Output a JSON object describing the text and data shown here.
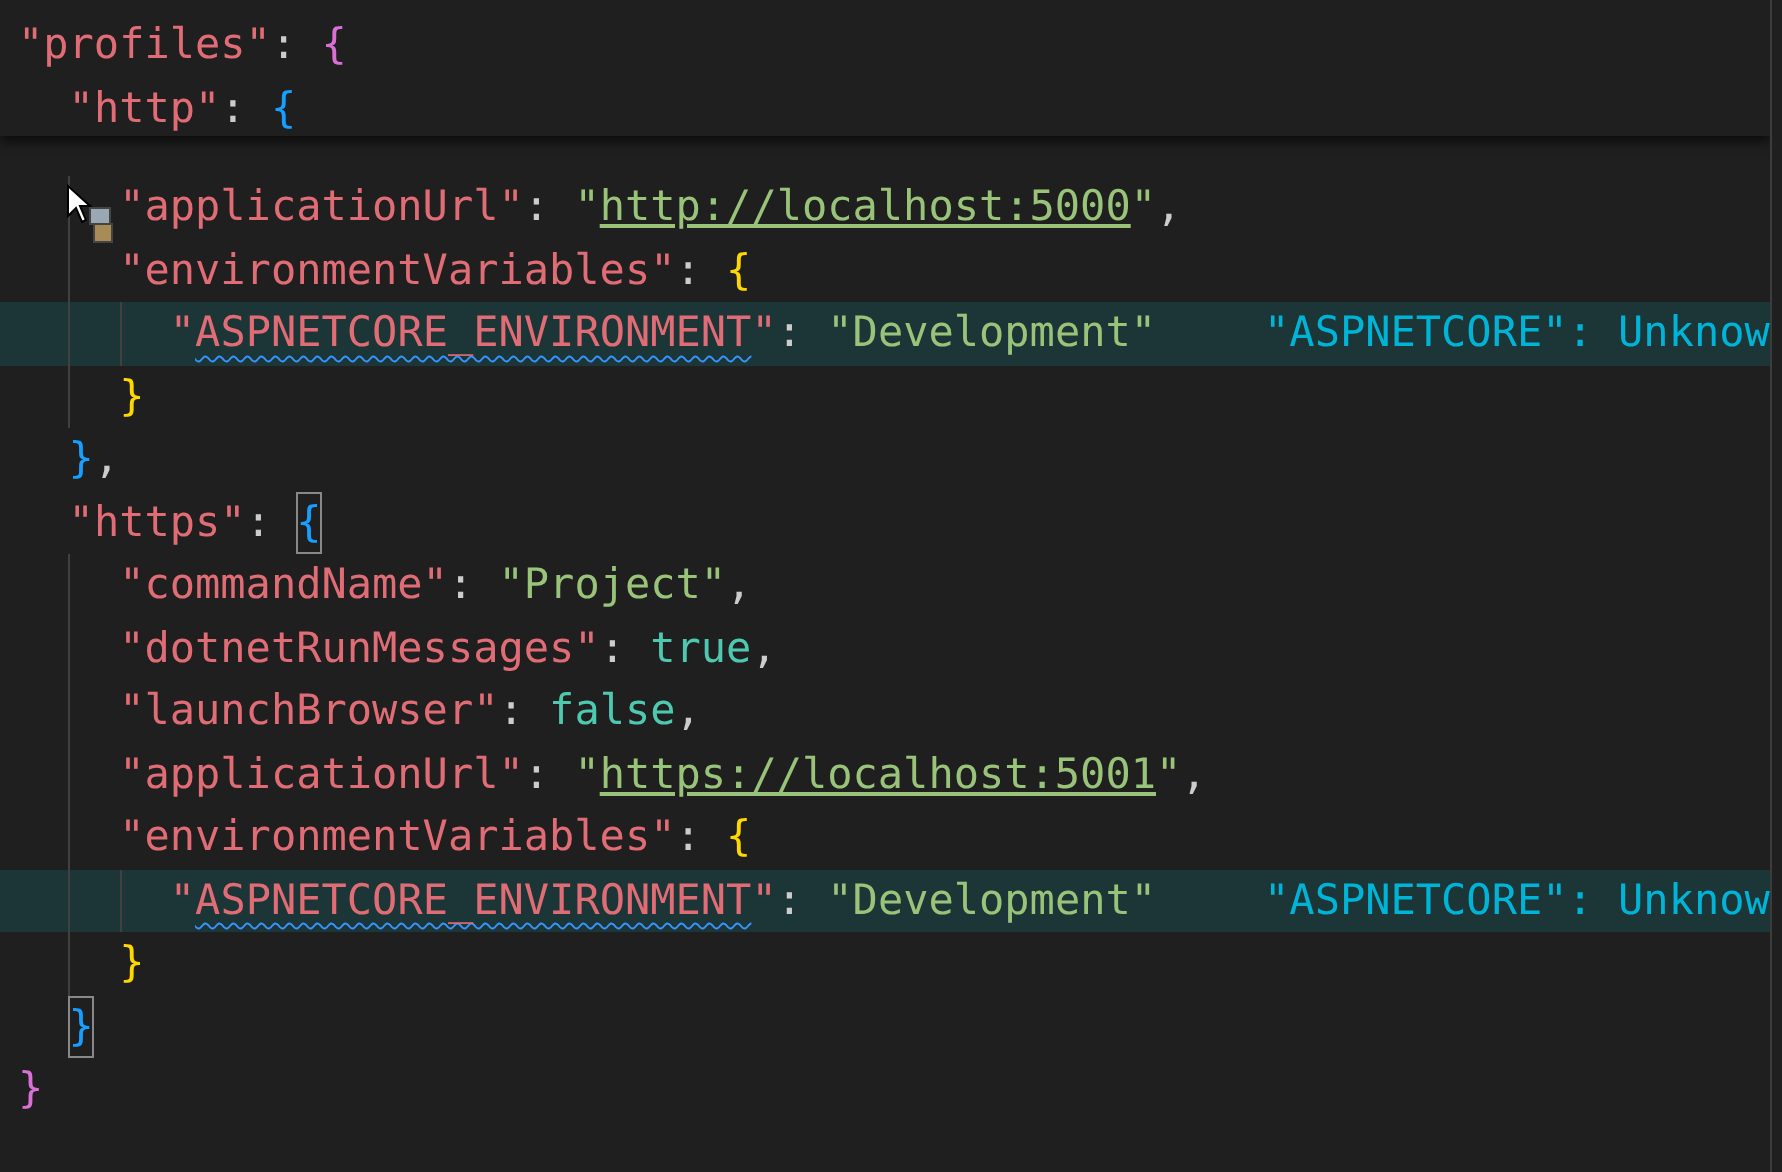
{
  "code": [
    {
      "sticky": true,
      "tokens": [
        {
          "kind": "key",
          "text": "\"profiles\""
        },
        {
          "kind": "punct",
          "text": ": "
        },
        {
          "kind": "brace",
          "text": "{",
          "color": "#da70d6",
          "bracket_match": false
        }
      ],
      "children": [
        {
          "sticky": true,
          "tokens": [
            {
              "kind": "key",
              "text": "\"http\""
            },
            {
              "kind": "punct",
              "text": ": "
            },
            {
              "kind": "brace",
              "text": "{",
              "color": "#179fff",
              "bracket_match": false
            }
          ],
          "children": [
            {
              "tokens": [
                {
                  "kind": "key",
                  "text": "\"applicationUrl\""
                },
                {
                  "kind": "punct",
                  "text": ": "
                },
                {
                  "kind": "string",
                  "text": "\""
                },
                {
                  "kind": "url",
                  "text": "http://localhost:5000"
                },
                {
                  "kind": "string",
                  "text": "\""
                },
                {
                  "kind": "punct",
                  "text": ","
                }
              ]
            },
            {
              "tokens": [
                {
                  "kind": "key",
                  "text": "\"environmentVariables\""
                },
                {
                  "kind": "punct",
                  "text": ": "
                },
                {
                  "kind": "brace",
                  "text": "{",
                  "color": "#ffd700",
                  "bracket_match": false
                }
              ],
              "children": [
                {
                  "highlighted": true,
                  "tokens": [
                    {
                      "kind": "key",
                      "text": "\""
                    },
                    {
                      "kind": "key",
                      "text": "ASPNETCORE_ENVIRONMENT",
                      "warning": true
                    },
                    {
                      "kind": "key",
                      "text": "\""
                    },
                    {
                      "kind": "punct",
                      "text": ": "
                    },
                    {
                      "kind": "string",
                      "text": "\"Development\""
                    },
                    {
                      "kind": "hint",
                      "text": "\"ASPNETCORE\": Unknow"
                    }
                  ]
                }
              ]
            },
            {
              "tokens": [
                {
                  "kind": "brace",
                  "text": "}",
                  "color": "#ffd700",
                  "bracket_match": false
                }
              ]
            }
          ]
        },
        {
          "tokens": [
            {
              "kind": "brace",
              "text": "}",
              "color": "#179fff",
              "bracket_match": false
            },
            {
              "kind": "punct",
              "text": ","
            }
          ]
        },
        {
          "tokens": [
            {
              "kind": "key",
              "text": "\"https\""
            },
            {
              "kind": "punct",
              "text": ": "
            },
            {
              "kind": "brace",
              "text": "{",
              "color": "#179fff",
              "bracket_match": true
            }
          ],
          "children": [
            {
              "tokens": [
                {
                  "kind": "key",
                  "text": "\"commandName\""
                },
                {
                  "kind": "punct",
                  "text": ": "
                },
                {
                  "kind": "string",
                  "text": "\"Project\""
                },
                {
                  "kind": "punct",
                  "text": ","
                }
              ]
            },
            {
              "tokens": [
                {
                  "kind": "key",
                  "text": "\"dotnetRunMessages\""
                },
                {
                  "kind": "punct",
                  "text": ": "
                },
                {
                  "kind": "bool",
                  "text": "true"
                },
                {
                  "kind": "punct",
                  "text": ","
                }
              ]
            },
            {
              "tokens": [
                {
                  "kind": "key",
                  "text": "\"launchBrowser\""
                },
                {
                  "kind": "punct",
                  "text": ": "
                },
                {
                  "kind": "bool",
                  "text": "false"
                },
                {
                  "kind": "punct",
                  "text": ","
                }
              ]
            },
            {
              "tokens": [
                {
                  "kind": "key",
                  "text": "\"applicationUrl\""
                },
                {
                  "kind": "punct",
                  "text": ": "
                },
                {
                  "kind": "string",
                  "text": "\""
                },
                {
                  "kind": "url",
                  "text": "https://localhost:5001"
                },
                {
                  "kind": "string",
                  "text": "\""
                },
                {
                  "kind": "punct",
                  "text": ","
                }
              ]
            },
            {
              "tokens": [
                {
                  "kind": "key",
                  "text": "\"environmentVariables\""
                },
                {
                  "kind": "punct",
                  "text": ": "
                },
                {
                  "kind": "brace",
                  "text": "{",
                  "color": "#ffd700",
                  "bracket_match": false
                }
              ],
              "children": [
                {
                  "highlighted": true,
                  "tokens": [
                    {
                      "kind": "key",
                      "text": "\""
                    },
                    {
                      "kind": "key",
                      "text": "ASPNETCORE_ENVIRONMENT",
                      "warning": true
                    },
                    {
                      "kind": "key",
                      "text": "\""
                    },
                    {
                      "kind": "punct",
                      "text": ": "
                    },
                    {
                      "kind": "string",
                      "text": "\"Development\""
                    },
                    {
                      "kind": "hint",
                      "text": "\"ASPNETCORE\": Unknow"
                    }
                  ]
                }
              ]
            },
            {
              "tokens": [
                {
                  "kind": "brace",
                  "text": "}",
                  "color": "#ffd700",
                  "bracket_match": false
                }
              ]
            }
          ]
        },
        {
          "tokens": [
            {
              "kind": "brace",
              "text": "}",
              "color": "#179fff",
              "bracket_match": true
            }
          ]
        }
      ]
    },
    {
      "tokens": [
        {
          "kind": "brace",
          "text": "}",
          "color": "#da70d6",
          "bracket_match": false
        }
      ]
    }
  ]
}
